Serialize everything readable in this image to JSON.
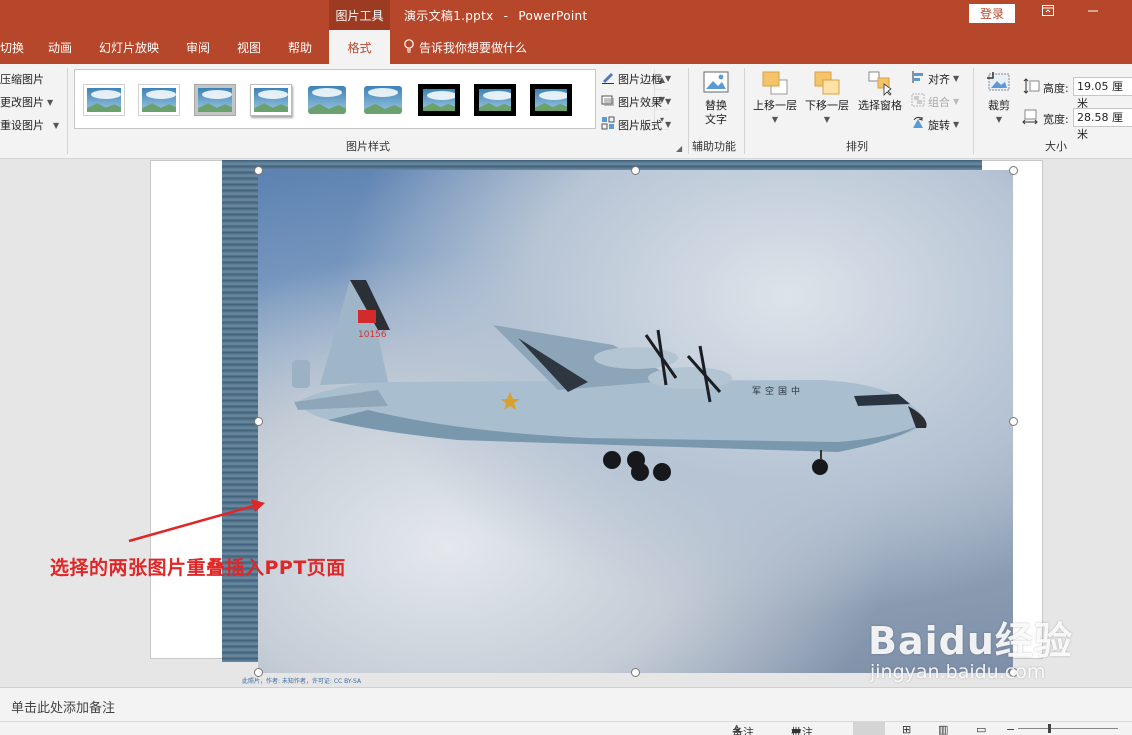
{
  "titlebar": {
    "context_tab": "图片工具",
    "doc_name": "演示文稿1.pptx",
    "separator": "-",
    "app_name": "PowerPoint",
    "login_label": "登录"
  },
  "tabs": [
    {
      "label": "切换"
    },
    {
      "label": "动画"
    },
    {
      "label": "幻灯片放映"
    },
    {
      "label": "审阅"
    },
    {
      "label": "视图"
    },
    {
      "label": "帮助"
    },
    {
      "label": "格式",
      "active": true
    }
  ],
  "tell_me": "告诉我你想要做什么",
  "adjust": {
    "items": [
      "压缩图片",
      "更改图片",
      "重设图片"
    ]
  },
  "picture_styles": {
    "group_label": "图片样式",
    "border_label": "图片边框",
    "effects_label": "图片效果",
    "layout_label": "图片版式"
  },
  "accessibility": {
    "alt_text_line1": "替换",
    "alt_text_line2": "文字",
    "group_label": "辅助功能"
  },
  "arrange": {
    "bring_forward": "上移一层",
    "send_backward": "下移一层",
    "selection_pane": "选择窗格",
    "align": "对齐",
    "group": "组合",
    "rotate": "旋转",
    "group_label": "排列"
  },
  "size": {
    "crop_label": "裁剪",
    "height_label": "高度:",
    "height_value": "19.05 厘米",
    "width_label": "宽度:",
    "width_value": "28.58 厘米",
    "group_label": "大小"
  },
  "slide": {
    "aircraft_tail_number": "10156",
    "aircraft_fuselage_text": "中国空军",
    "caption": "此照片，作者: 未知作者，许可证: CC BY-SA",
    "annotation": "选择的两张图片重叠插入PPT页面",
    "watermark_main": "Baidu经验",
    "watermark_sub": "jingyan.baidu.com"
  },
  "notes_placeholder": "单击此处添加备注",
  "status": {
    "notes_label": "备注",
    "comments_label": "批注"
  },
  "colors": {
    "accent": "#b7472a",
    "annotation_red": "#e02727"
  }
}
